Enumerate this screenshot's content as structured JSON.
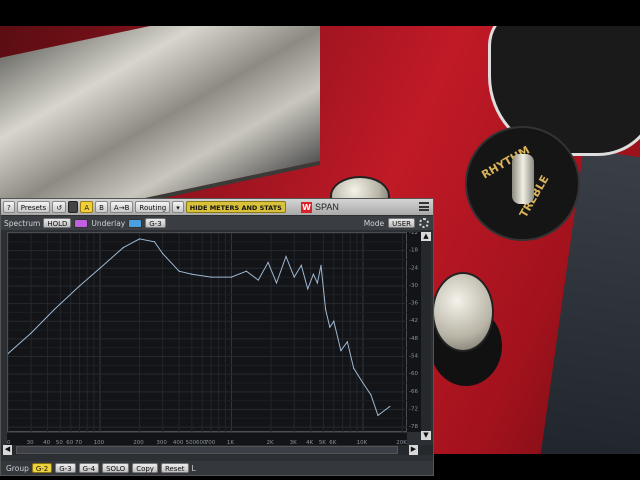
{
  "toolbar": {
    "help_label": "?",
    "presets_label": "Presets",
    "undo_icon": "undo-icon",
    "a_label": "A",
    "b_label": "B",
    "ab_label": "A→B",
    "routing_label": "Routing",
    "hide_meters_label": "HIDE METERS AND STATS",
    "brand_logo": "W",
    "plugin_name": "SPAN"
  },
  "spectrum_bar": {
    "spectrum_label": "Spectrum",
    "hold_label": "HOLD",
    "underlay_label": "Underlay",
    "underlay_slot": "G-3",
    "mode_label": "Mode",
    "mode_value": "USER",
    "hold_color": "#c060e0",
    "underlay_color": "#4aa0e0"
  },
  "y_ticks": [
    "-12",
    "-18",
    "-24",
    "-30",
    "-36",
    "-42",
    "-48",
    "-54",
    "-60",
    "-66",
    "-72",
    "-78"
  ],
  "x_ticks": [
    "20",
    "30",
    "40",
    "50",
    "60",
    "70",
    "100",
    "200",
    "300",
    "400",
    "500",
    "600",
    "700",
    "1K",
    "2K",
    "3K",
    "4K",
    "5K",
    "6K",
    "10K",
    "20K"
  ],
  "groups": {
    "group_label": "Group",
    "g2": "G-2",
    "g3": "G-3",
    "g4": "G-4",
    "solo": "SOLO",
    "copy": "Copy",
    "reset": "Reset",
    "channel": "L"
  },
  "chart_data": {
    "type": "line",
    "xlabel": "",
    "ylabel": "",
    "xscale": "log",
    "xlim": [
      20,
      22000
    ],
    "ylim": [
      -80,
      -12
    ],
    "series": [
      {
        "color": "#9fb7d3",
        "x": [
          20,
          30,
          45,
          70,
          100,
          150,
          200,
          260,
          300,
          400,
          500,
          700,
          1000,
          1300,
          1600,
          1900,
          2200,
          2600,
          3000,
          3400,
          3800,
          4200,
          4500,
          4800,
          5200,
          5600,
          6000,
          6800,
          7600,
          8500,
          10000,
          11500,
          13000,
          16000
        ],
        "y": [
          -53,
          -46,
          -38,
          -30,
          -24,
          -17,
          -14,
          -15,
          -19,
          -25,
          -26,
          -27,
          -27,
          -25,
          -28,
          -22,
          -29,
          -20,
          -27,
          -23,
          -31,
          -26,
          -29,
          -23,
          -38,
          -44,
          -42,
          -52,
          -49,
          -58,
          -63,
          -67,
          -74,
          -71
        ]
      }
    ]
  }
}
